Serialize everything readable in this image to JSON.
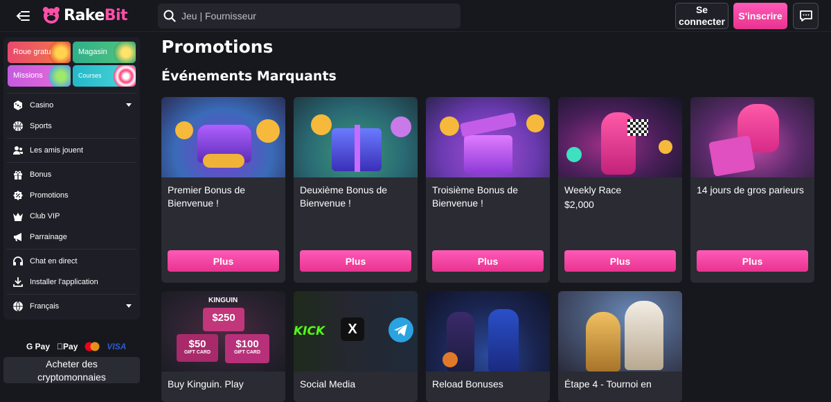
{
  "header": {
    "logo_text_1": "Rake",
    "logo_text_2": "Bit",
    "search_placeholder": "Jeu | Fournisseur",
    "login_label_line1": "Se",
    "login_label_line2": "connecter",
    "signup_label": "S'inscrire",
    "accent": "#ff4fa8"
  },
  "sidebar": {
    "tiles": [
      {
        "label": "Roue gratu"
      },
      {
        "label": "Magasin"
      },
      {
        "label": "Missions"
      },
      {
        "label": "Courses"
      }
    ],
    "items": [
      {
        "label": "Casino",
        "icon": "casino-icon"
      },
      {
        "label": "Sports",
        "icon": "basketball-icon"
      },
      {
        "label": "Les amis jouent",
        "icon": "friends-icon"
      },
      {
        "label": "Bonus",
        "icon": "gift-icon"
      },
      {
        "label": "Promotions",
        "icon": "promotion-tag-icon"
      },
      {
        "label": "Club VIP",
        "icon": "crown-icon"
      },
      {
        "label": "Parrainage",
        "icon": "megaphone-icon"
      },
      {
        "label": "Chat en direct",
        "icon": "headset-icon"
      },
      {
        "label": "Installer l'application",
        "icon": "download-icon"
      },
      {
        "label": "Français",
        "icon": "globe-icon"
      }
    ],
    "payments": [
      "G Pay",
      "Pay",
      "VISA"
    ],
    "buy_crypto_line1": "Acheter des",
    "buy_crypto_line2": "cryptomonnaies"
  },
  "main": {
    "title": "Promotions",
    "section": "Événements Marquants",
    "cards": [
      {
        "title": "Premier Bonus de Bienvenue !",
        "price": "",
        "button": "Plus"
      },
      {
        "title": "Deuxième Bonus de Bienvenue !",
        "price": "",
        "button": "Plus"
      },
      {
        "title": "Troisième Bonus de Bienvenue !",
        "price": "",
        "button": "Plus"
      },
      {
        "title": "Weekly Race",
        "price": "$2,000",
        "button": "Plus"
      },
      {
        "title": "14 jours de gros parieurs",
        "price": "",
        "button": "Plus"
      },
      {
        "title": "Buy Kinguin. Play"
      },
      {
        "title": "Social Media"
      },
      {
        "title": "Reload Bonuses"
      },
      {
        "title": "Étape 4 - Tournoi en"
      }
    ],
    "kinguin": {
      "brand": "KINGUIN",
      "card1": "$250",
      "card2": "$50",
      "card3": "$100",
      "gift": "GIFT CARD"
    },
    "social": {
      "kick": "KICK",
      "x": "X"
    }
  }
}
